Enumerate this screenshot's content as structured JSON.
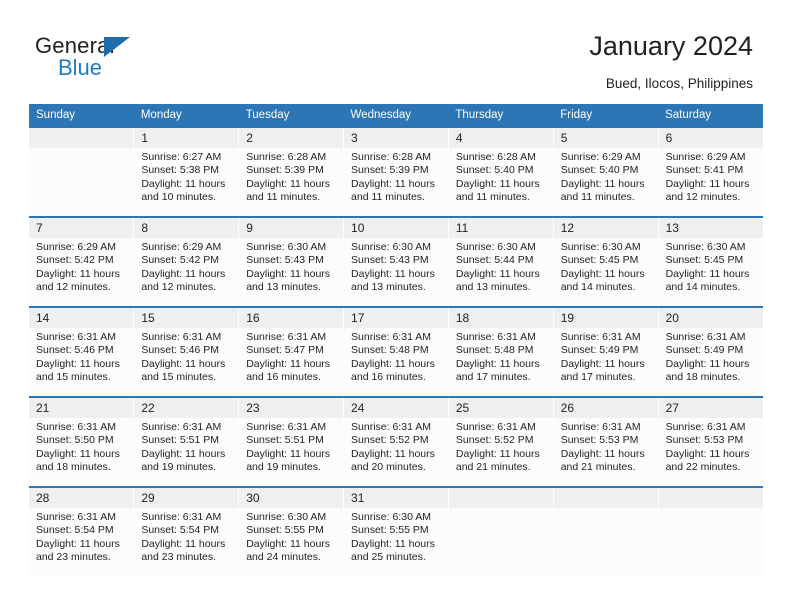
{
  "logo": {
    "word1": "General",
    "word2": "Blue",
    "triangle_color": "#1f6cb0",
    "blue_color": "#1f7ac4"
  },
  "header": {
    "title": "January 2024",
    "subtitle": "Bued, Ilocos, Philippines"
  },
  "theme": {
    "header_bg": "#2d76b5",
    "daynum_bg": "#efefef",
    "cell_bg": "#fcfcfc",
    "text": "#231f20"
  },
  "calendar": {
    "day_headers": [
      "Sunday",
      "Monday",
      "Tuesday",
      "Wednesday",
      "Thursday",
      "Friday",
      "Saturday"
    ],
    "weeks": [
      [
        {
          "day": "",
          "lines": []
        },
        {
          "day": "1",
          "lines": [
            "Sunrise: 6:27 AM",
            "Sunset: 5:38 PM",
            "Daylight: 11 hours and 10 minutes."
          ]
        },
        {
          "day": "2",
          "lines": [
            "Sunrise: 6:28 AM",
            "Sunset: 5:39 PM",
            "Daylight: 11 hours and 11 minutes."
          ]
        },
        {
          "day": "3",
          "lines": [
            "Sunrise: 6:28 AM",
            "Sunset: 5:39 PM",
            "Daylight: 11 hours and 11 minutes."
          ]
        },
        {
          "day": "4",
          "lines": [
            "Sunrise: 6:28 AM",
            "Sunset: 5:40 PM",
            "Daylight: 11 hours and 11 minutes."
          ]
        },
        {
          "day": "5",
          "lines": [
            "Sunrise: 6:29 AM",
            "Sunset: 5:40 PM",
            "Daylight: 11 hours and 11 minutes."
          ]
        },
        {
          "day": "6",
          "lines": [
            "Sunrise: 6:29 AM",
            "Sunset: 5:41 PM",
            "Daylight: 11 hours and 12 minutes."
          ]
        }
      ],
      [
        {
          "day": "7",
          "lines": [
            "Sunrise: 6:29 AM",
            "Sunset: 5:42 PM",
            "Daylight: 11 hours and 12 minutes."
          ]
        },
        {
          "day": "8",
          "lines": [
            "Sunrise: 6:29 AM",
            "Sunset: 5:42 PM",
            "Daylight: 11 hours and 12 minutes."
          ]
        },
        {
          "day": "9",
          "lines": [
            "Sunrise: 6:30 AM",
            "Sunset: 5:43 PM",
            "Daylight: 11 hours and 13 minutes."
          ]
        },
        {
          "day": "10",
          "lines": [
            "Sunrise: 6:30 AM",
            "Sunset: 5:43 PM",
            "Daylight: 11 hours and 13 minutes."
          ]
        },
        {
          "day": "11",
          "lines": [
            "Sunrise: 6:30 AM",
            "Sunset: 5:44 PM",
            "Daylight: 11 hours and 13 minutes."
          ]
        },
        {
          "day": "12",
          "lines": [
            "Sunrise: 6:30 AM",
            "Sunset: 5:45 PM",
            "Daylight: 11 hours and 14 minutes."
          ]
        },
        {
          "day": "13",
          "lines": [
            "Sunrise: 6:30 AM",
            "Sunset: 5:45 PM",
            "Daylight: 11 hours and 14 minutes."
          ]
        }
      ],
      [
        {
          "day": "14",
          "lines": [
            "Sunrise: 6:31 AM",
            "Sunset: 5:46 PM",
            "Daylight: 11 hours and 15 minutes."
          ]
        },
        {
          "day": "15",
          "lines": [
            "Sunrise: 6:31 AM",
            "Sunset: 5:46 PM",
            "Daylight: 11 hours and 15 minutes."
          ]
        },
        {
          "day": "16",
          "lines": [
            "Sunrise: 6:31 AM",
            "Sunset: 5:47 PM",
            "Daylight: 11 hours and 16 minutes."
          ]
        },
        {
          "day": "17",
          "lines": [
            "Sunrise: 6:31 AM",
            "Sunset: 5:48 PM",
            "Daylight: 11 hours and 16 minutes."
          ]
        },
        {
          "day": "18",
          "lines": [
            "Sunrise: 6:31 AM",
            "Sunset: 5:48 PM",
            "Daylight: 11 hours and 17 minutes."
          ]
        },
        {
          "day": "19",
          "lines": [
            "Sunrise: 6:31 AM",
            "Sunset: 5:49 PM",
            "Daylight: 11 hours and 17 minutes."
          ]
        },
        {
          "day": "20",
          "lines": [
            "Sunrise: 6:31 AM",
            "Sunset: 5:49 PM",
            "Daylight: 11 hours and 18 minutes."
          ]
        }
      ],
      [
        {
          "day": "21",
          "lines": [
            "Sunrise: 6:31 AM",
            "Sunset: 5:50 PM",
            "Daylight: 11 hours and 18 minutes."
          ]
        },
        {
          "day": "22",
          "lines": [
            "Sunrise: 6:31 AM",
            "Sunset: 5:51 PM",
            "Daylight: 11 hours and 19 minutes."
          ]
        },
        {
          "day": "23",
          "lines": [
            "Sunrise: 6:31 AM",
            "Sunset: 5:51 PM",
            "Daylight: 11 hours and 19 minutes."
          ]
        },
        {
          "day": "24",
          "lines": [
            "Sunrise: 6:31 AM",
            "Sunset: 5:52 PM",
            "Daylight: 11 hours and 20 minutes."
          ]
        },
        {
          "day": "25",
          "lines": [
            "Sunrise: 6:31 AM",
            "Sunset: 5:52 PM",
            "Daylight: 11 hours and 21 minutes."
          ]
        },
        {
          "day": "26",
          "lines": [
            "Sunrise: 6:31 AM",
            "Sunset: 5:53 PM",
            "Daylight: 11 hours and 21 minutes."
          ]
        },
        {
          "day": "27",
          "lines": [
            "Sunrise: 6:31 AM",
            "Sunset: 5:53 PM",
            "Daylight: 11 hours and 22 minutes."
          ]
        }
      ],
      [
        {
          "day": "28",
          "lines": [
            "Sunrise: 6:31 AM",
            "Sunset: 5:54 PM",
            "Daylight: 11 hours and 23 minutes."
          ]
        },
        {
          "day": "29",
          "lines": [
            "Sunrise: 6:31 AM",
            "Sunset: 5:54 PM",
            "Daylight: 11 hours and 23 minutes."
          ]
        },
        {
          "day": "30",
          "lines": [
            "Sunrise: 6:30 AM",
            "Sunset: 5:55 PM",
            "Daylight: 11 hours and 24 minutes."
          ]
        },
        {
          "day": "31",
          "lines": [
            "Sunrise: 6:30 AM",
            "Sunset: 5:55 PM",
            "Daylight: 11 hours and 25 minutes."
          ]
        },
        {
          "day": "",
          "lines": []
        },
        {
          "day": "",
          "lines": []
        },
        {
          "day": "",
          "lines": []
        }
      ]
    ]
  }
}
